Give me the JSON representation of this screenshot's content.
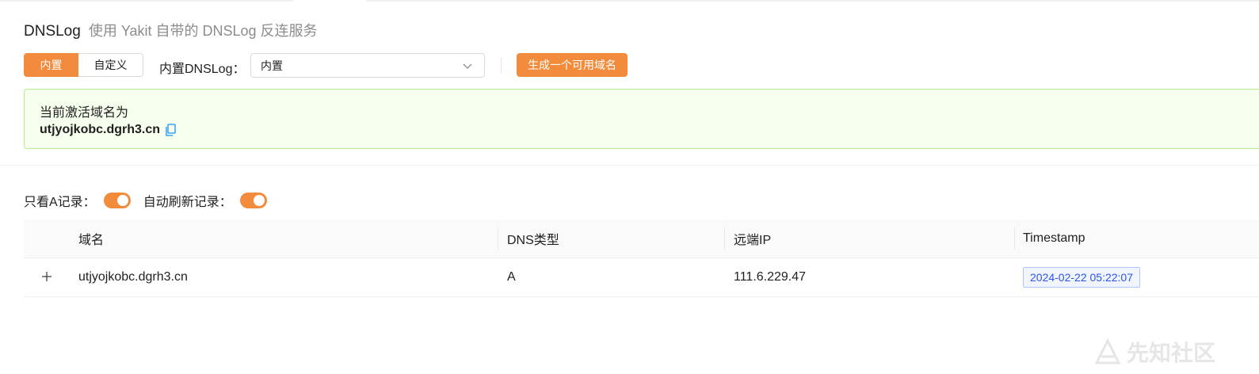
{
  "header": {
    "title": "DNSLog",
    "subtitle": "使用 Yakit 自带的 DNSLog 反连服务"
  },
  "mode": {
    "builtin_label": "内置",
    "custom_label": "自定义"
  },
  "dns_select": {
    "label": "内置DNSLog：",
    "value": "内置"
  },
  "generate_button": "生成一个可用域名",
  "active_domain": {
    "label": "当前激活域名为",
    "domain": "utjyojkobc.dgrh3.cn"
  },
  "filters": {
    "only_a_label": "只看A记录：",
    "only_a_on": true,
    "auto_refresh_label": "自动刷新记录：",
    "auto_refresh_on": true
  },
  "table": {
    "columns": [
      "域名",
      "DNS类型",
      "远端IP",
      "Timestamp"
    ],
    "rows": [
      {
        "domain": "utjyojkobc.dgrh3.cn",
        "type": "A",
        "ip": "111.6.229.47",
        "timestamp": "2024-02-22 05:22:07"
      }
    ]
  },
  "watermark": "先知社区",
  "colors": {
    "accent": "#f28b3c",
    "success_bg": "#f6ffed",
    "success_border": "#b7eb8f",
    "tag_blue": "#2f54eb"
  }
}
